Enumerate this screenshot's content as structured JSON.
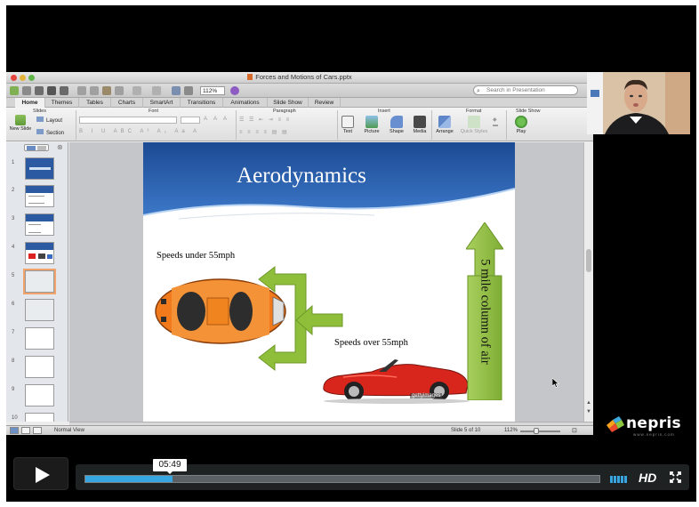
{
  "window": {
    "title": "Forces and Motions of Cars.pptx",
    "zoom": "112%",
    "search_placeholder": "Search in Presentation"
  },
  "ribbon_tabs": [
    {
      "label": "Home",
      "active": true
    },
    {
      "label": "Themes"
    },
    {
      "label": "Tables"
    },
    {
      "label": "Charts"
    },
    {
      "label": "SmartArt"
    },
    {
      "label": "Transitions"
    },
    {
      "label": "Animations"
    },
    {
      "label": "Slide Show"
    },
    {
      "label": "Review"
    }
  ],
  "ribbon": {
    "groups": {
      "slides": "Slides",
      "font": "Font",
      "paragraph": "Paragraph",
      "insert": "Insert",
      "format": "Format",
      "slide_show": "Slide Show"
    },
    "new_slide": "New Slide",
    "layout": "Layout",
    "section": "Section",
    "text": "Text",
    "picture": "Picture",
    "shape": "Shape",
    "media": "Media",
    "arrange": "Arrange",
    "quick_styles": "Quick Styles",
    "play": "Play"
  },
  "slide_pane": {
    "numbers": [
      "1",
      "2",
      "3",
      "4",
      "5",
      "6",
      "7",
      "8",
      "9",
      "10"
    ],
    "selected": 5
  },
  "slide": {
    "title": "Aerodynamics",
    "speeds_under": "Speeds under 55mph",
    "speeds_over": "Speeds over 55mph",
    "air_column": "5 mile column of air",
    "watermark": "gettyimages"
  },
  "status": {
    "view": "Normal View",
    "slide_counter": "Slide 5 of 10",
    "zoom": "112%"
  },
  "player": {
    "time": "05:49",
    "progress": 0.17,
    "hd": "HD"
  },
  "brand": {
    "name": "nepris",
    "url": "www.nepris.com"
  },
  "colors": {
    "slide_blue": "#2f64b4",
    "arrow_green": "#8fbf3a",
    "car_orange": "#f07a1c",
    "car_red": "#d8261c",
    "progress_blue": "#37a5e0"
  }
}
